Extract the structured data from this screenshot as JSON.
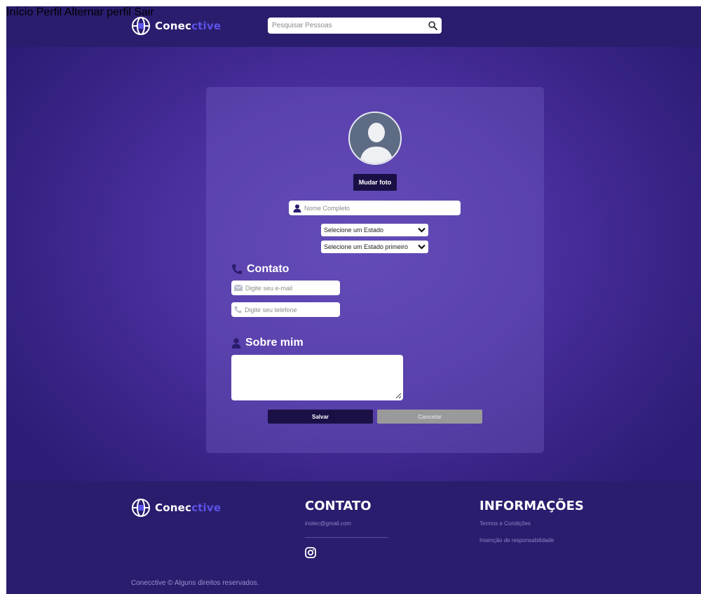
{
  "brand": {
    "name_part1": "Conec",
    "name_part2": "ctive"
  },
  "header": {
    "search_placeholder": "Pesquisar Pessoas",
    "nav": [
      "Início",
      "Perfil",
      "Alternar perfil",
      "Sair"
    ]
  },
  "profile": {
    "change_photo_label": "Mudar foto",
    "name_placeholder": "Nome Completo",
    "state_select": "Selecione um Estado",
    "city_select": "Selecione um Estado primeiro",
    "contact_title": "Contato",
    "email_placeholder": "Digite seu e-mail",
    "phone_placeholder": "Digite seu telefone",
    "about_title": "Sobre mim",
    "save_label": "Salvar",
    "cancel_label": "Cancelar"
  },
  "footer": {
    "contact_title": "CONTATO",
    "contact_email": "inotec@gmail.com",
    "info_title": "INFORMAÇÕES",
    "info_links": [
      "Termos e Condições",
      "Insenção de responsabilidade"
    ],
    "copyright": "Conecctive © Alguns direitos reservados."
  },
  "colors": {
    "header_bg": "#2a1d6e",
    "accent": "#5b52e8",
    "button_dark": "#1b1045",
    "button_disabled": "#9a9a9a"
  },
  "icons": [
    "globe-icon",
    "search-icon",
    "user-icon",
    "phone-icon",
    "mail-icon",
    "chevron-down-icon",
    "instagram-icon"
  ]
}
